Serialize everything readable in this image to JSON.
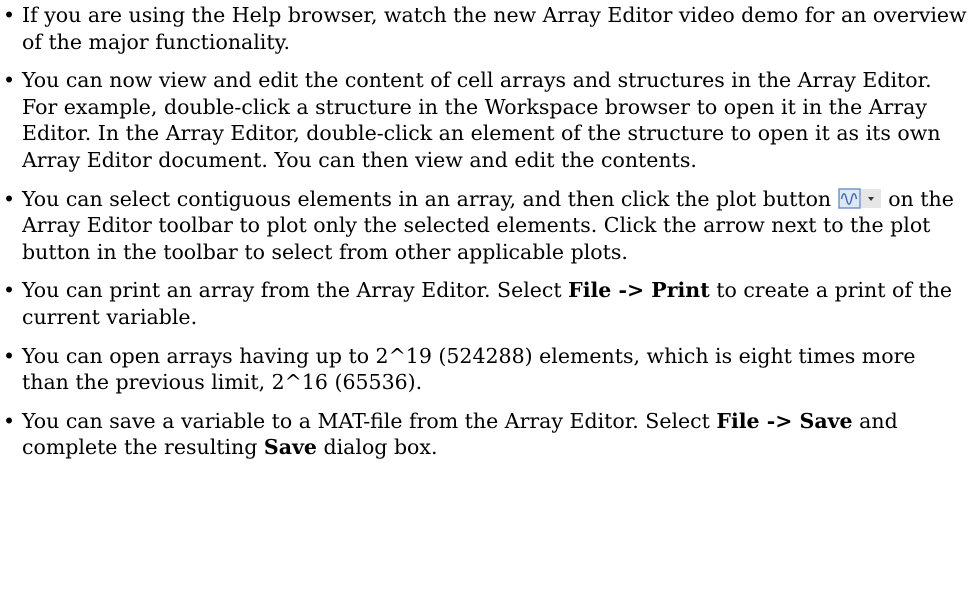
{
  "bullets": [
    {
      "text": "If you are using the Help browser, watch the new Array Editor video demo for an overview of the major functionality."
    },
    {
      "text": "You can now view and edit the content of cell arrays and structures in the Array Editor. For example, double-click a structure in the Workspace browser to open it in the Array Editor. In the Array Editor, double-click an element of the structure to open it as its own Array Editor document. You can then view and edit the contents."
    },
    {
      "before": "You can select contiguous elements in an array, and then click the plot button",
      "after": "on the Array Editor toolbar to plot only the selected elements. Click the arrow next to the plot button in the toolbar to select from other applicable plots.",
      "icon": "plot-button-icon"
    },
    {
      "before": "You can print an array from the Array Editor. Select",
      "bold1": "File -> Print",
      "after": "to create a print of the current variable."
    },
    {
      "text": "You can open arrays having up to 2^19 (524288) elements, which is eight times more than the previous limit, 2^16 (65536)."
    },
    {
      "before": "You can save a variable to a MAT-file from the Array Editor. Select",
      "bold1": "File -> Save",
      "middle": "and complete the resulting",
      "bold2": "Save",
      "after": "dialog box."
    }
  ],
  "bullet_symbol": "•",
  "colors": {
    "text": "#000000",
    "icon_border": "#6b8fc7",
    "icon_fill": "#dde8f6",
    "icon_wave": "#3b66b6",
    "dropdown_bg": "#e6e6e6"
  }
}
